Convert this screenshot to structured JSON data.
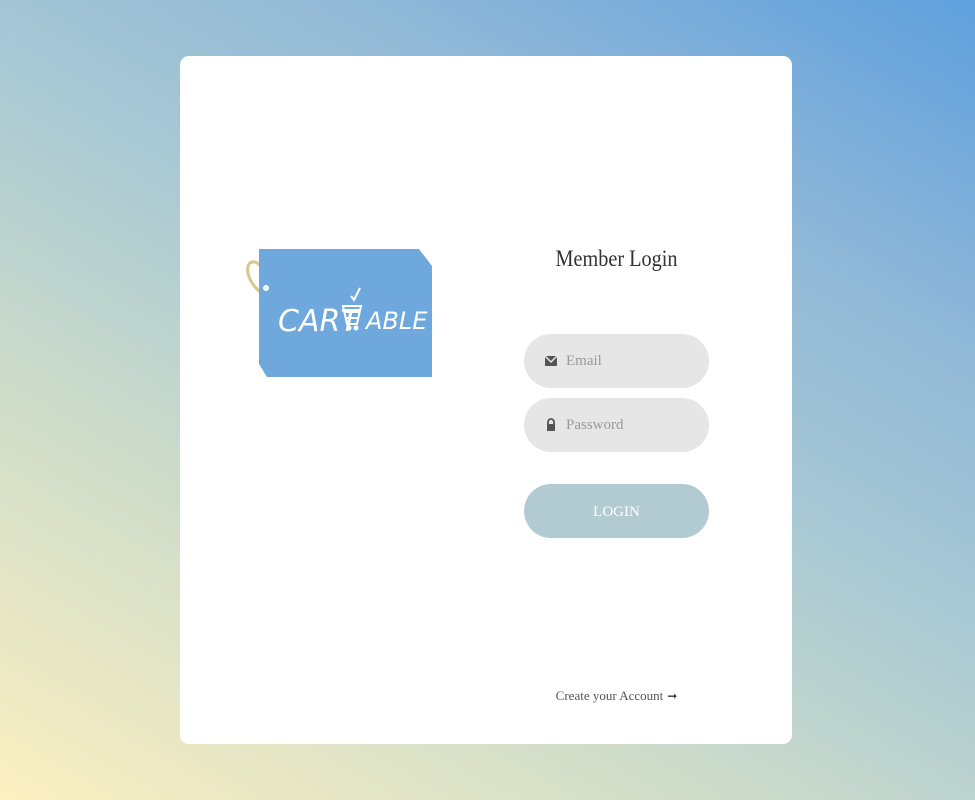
{
  "logo": {
    "text": "CART ABLE",
    "colors": {
      "tag": "#6fa8dc",
      "text": "#ffffff",
      "string": "#d6c88c"
    },
    "icon": "cart-check-icon"
  },
  "login": {
    "title": "Member Login",
    "email_placeholder": "Email",
    "email_icon": "envelope-icon",
    "password_placeholder": "Password",
    "password_icon": "lock-icon",
    "submit_label": "LOGIN",
    "create_account_label": "Create your Account",
    "create_account_icon": "arrow-right-icon"
  },
  "colors": {
    "card": "#ffffff",
    "field_bg": "#e6e6e6",
    "button_bg": "#b2cbd2",
    "button_text": "#ffffff"
  }
}
